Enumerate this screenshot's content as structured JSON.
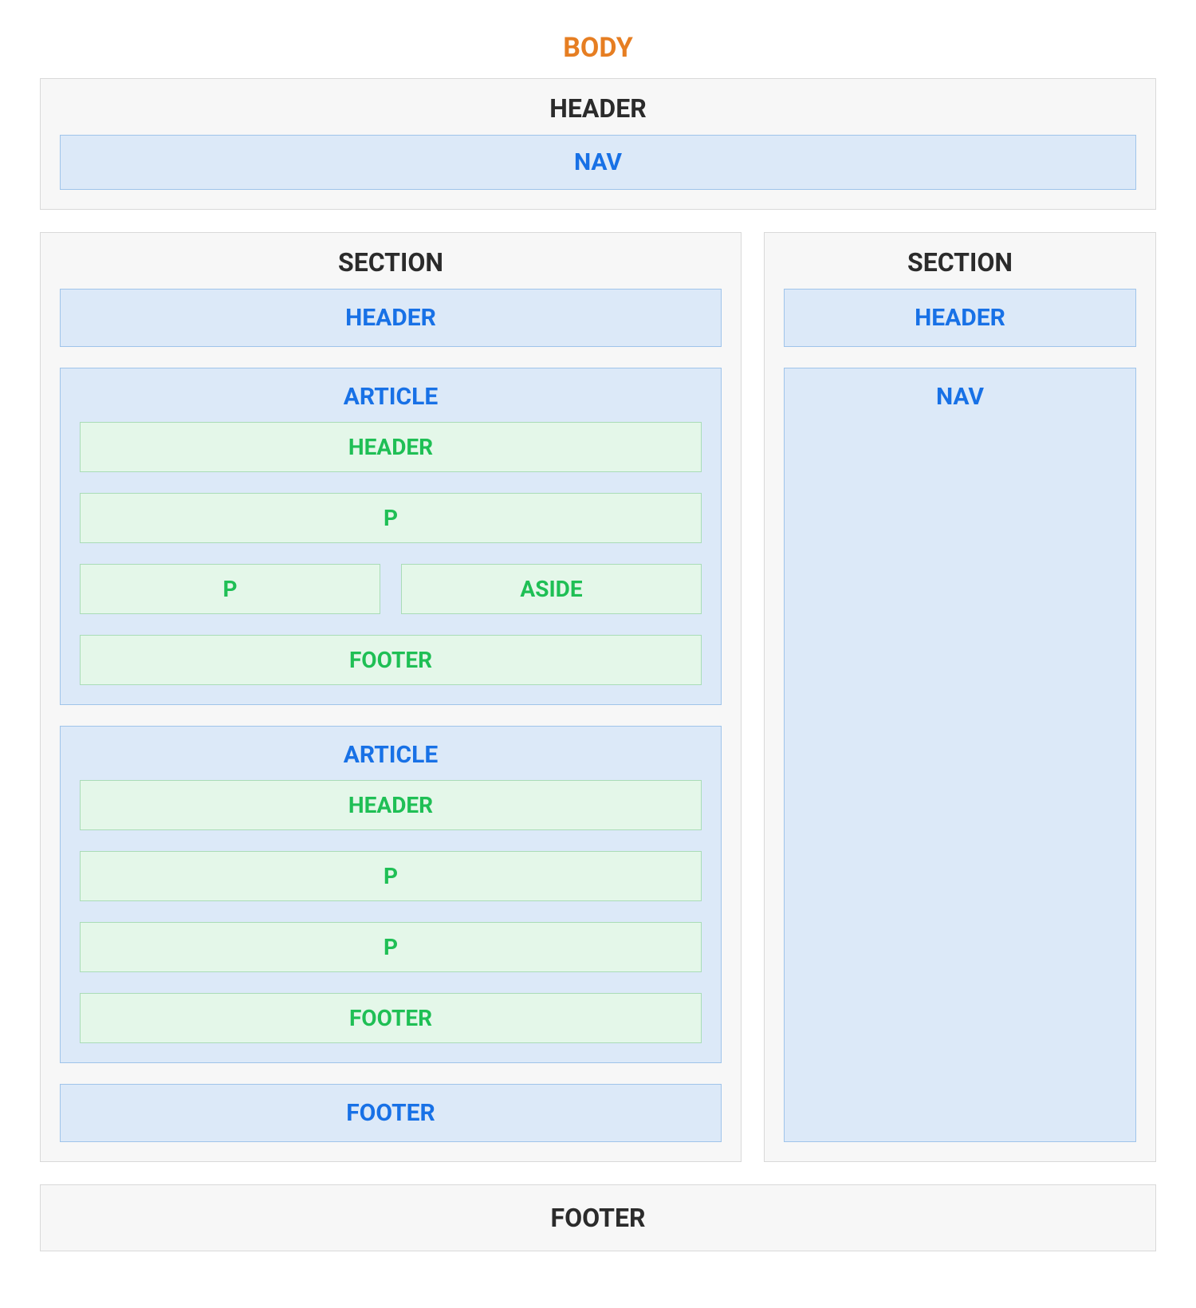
{
  "body_label": "BODY",
  "top_header": {
    "label": "HEADER",
    "nav_label": "NAV"
  },
  "left_section": {
    "label": "SECTION",
    "header_label": "HEADER",
    "article1": {
      "label": "ARTICLE",
      "header_label": "HEADER",
      "p1_label": "P",
      "p2_label": "P",
      "aside_label": "ASIDE",
      "footer_label": "FOOTER"
    },
    "article2": {
      "label": "ARTICLE",
      "header_label": "HEADER",
      "p1_label": "P",
      "p2_label": "P",
      "footer_label": "FOOTER"
    },
    "footer_label": "FOOTER"
  },
  "right_section": {
    "label": "SECTION",
    "header_label": "HEADER",
    "nav_label": "NAV"
  },
  "footer_label": "FOOTER",
  "colors": {
    "body_label": "#e67e22",
    "l1_text": "#2b2b2b",
    "l1_bg": "#f7f7f7",
    "l1_border": "#d9d9d9",
    "l2_text": "#1871e6",
    "l2_bg": "#dce9f8",
    "l2_border": "#9fc4ea",
    "l3_text": "#1fbf55",
    "l3_bg": "#e4f7e9",
    "l3_border": "#a9dcb7"
  }
}
